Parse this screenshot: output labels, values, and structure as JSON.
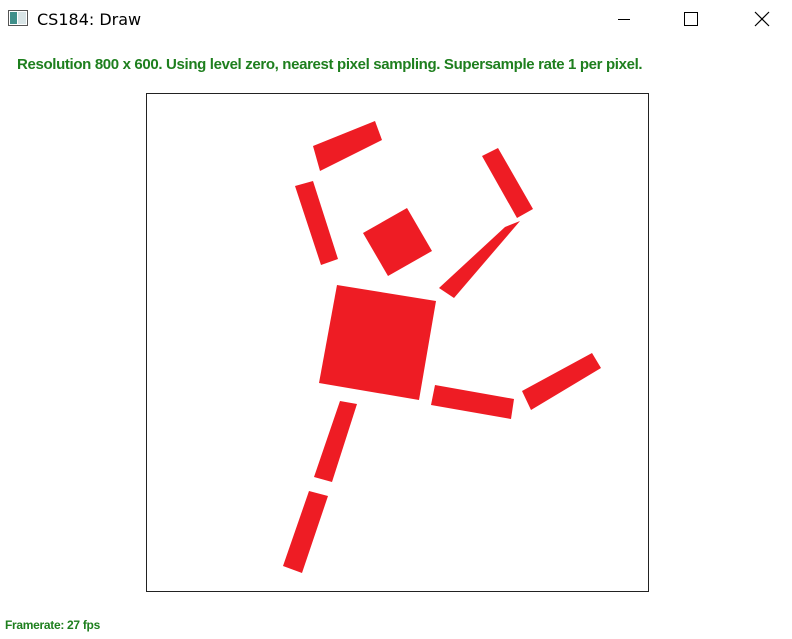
{
  "window": {
    "title": "CS184: Draw",
    "app_icon": "app-window-icon",
    "controls": {
      "minimize_icon": "minimize-icon",
      "maximize_icon": "maximize-icon",
      "close_icon": "close-icon"
    }
  },
  "status": {
    "message": "Resolution 800 x 600. Using level zero, nearest pixel sampling. Supersample rate 1 per pixel.",
    "color": "#1e7f1e"
  },
  "canvas": {
    "shape_color": "#ee1c24",
    "shapes": [
      "left-forearm",
      "left-upper-arm",
      "head",
      "right-forearm",
      "right-upper-arm",
      "torso",
      "right-thigh",
      "right-shin",
      "left-thigh",
      "left-shin"
    ]
  },
  "footer": {
    "framerate": "Framerate: 27 fps"
  }
}
